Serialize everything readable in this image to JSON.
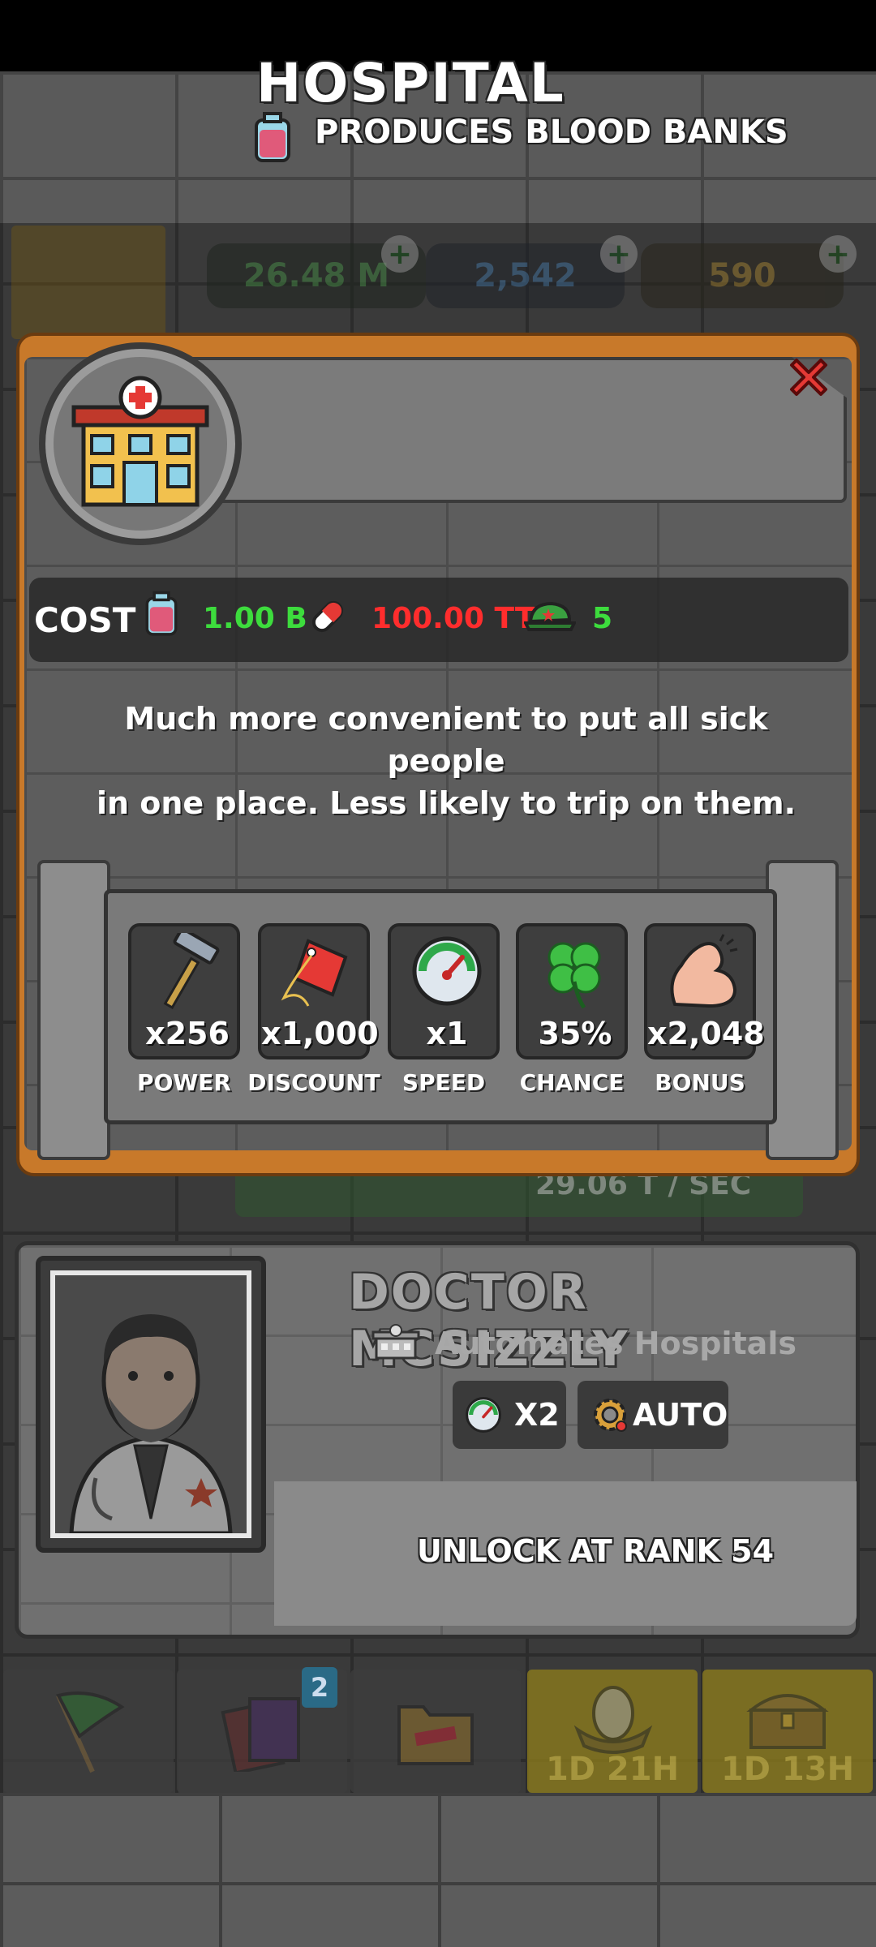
{
  "background": {
    "resources": {
      "money": "26.48 M",
      "flask": "2,542",
      "gold": "590"
    },
    "status_value": "29.06 T / SEC",
    "nav": {
      "badge_count": "2",
      "timer_1": "1D 21H",
      "timer_2": "1D 13H"
    }
  },
  "building": {
    "title": "HOSPITAL",
    "produces": "PRODUCES BLOOD BANKS",
    "icon": "hospital-building-icon"
  },
  "cost": {
    "label": "COST",
    "items": [
      {
        "icon": "blood-bank-icon",
        "value": "1.00 B",
        "color": "#3ddc3d"
      },
      {
        "icon": "pill-icon",
        "value": "100.00 TT",
        "color": "#ff2d2d"
      },
      {
        "icon": "army-cap-icon",
        "value": "5",
        "color": "#3ddc3d"
      }
    ]
  },
  "description": {
    "line1": "Much more convenient to put all sick people",
    "line2": "in one place. Less likely to trip on them."
  },
  "stats": [
    {
      "icon": "hammer-icon",
      "value": "x256",
      "label": "POWER"
    },
    {
      "icon": "price-tag-icon",
      "value": "x1,000",
      "label": "DISCOUNT"
    },
    {
      "icon": "speedometer-icon",
      "value": "x1",
      "label": "SPEED"
    },
    {
      "icon": "four-leaf-clover-icon",
      "value": "35%",
      "label": "CHANCE"
    },
    {
      "icon": "flexed-arm-icon",
      "value": "x2,048",
      "label": "BONUS"
    }
  ],
  "manager": {
    "name": "DOCTOR MCSIZZLY",
    "subtitle": "Automates Hospitals",
    "speed_boost": "X2",
    "auto_label": "AUTO",
    "unlock": "UNLOCK AT RANK 54"
  },
  "colors": {
    "panel_frame": "#c8792a",
    "cost_green": "#3ddc3d",
    "cost_red": "#ff2d2d"
  }
}
